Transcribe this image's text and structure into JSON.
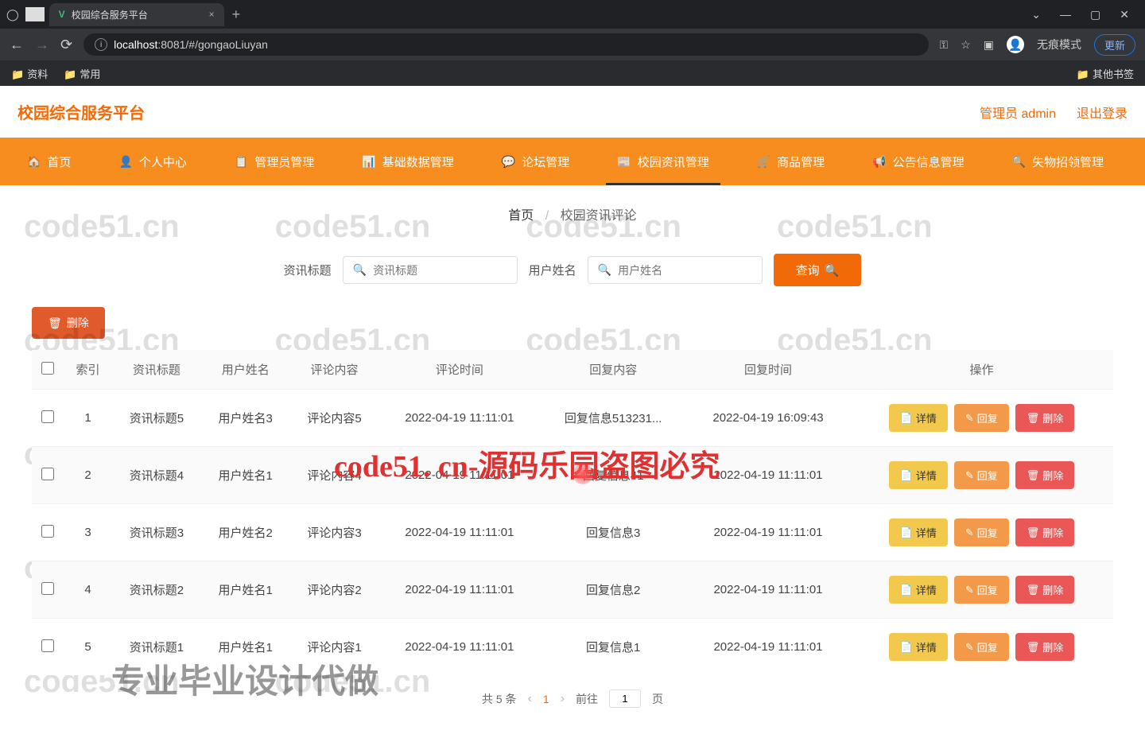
{
  "browser": {
    "tab_title": "校园综合服务平台",
    "url_host": "localhost",
    "url_rest": ":8081/#/gongaoLiuyan",
    "incognito_label": "无痕模式",
    "update_label": "更新",
    "bookmarks": [
      "资料",
      "常用"
    ],
    "other_bookmarks": "其他书签"
  },
  "header": {
    "title": "校园综合服务平台",
    "user_label": "管理员 admin",
    "logout": "退出登录"
  },
  "nav": {
    "items": [
      {
        "icon": "🏠",
        "label": "首页"
      },
      {
        "icon": "👤",
        "label": "个人中心"
      },
      {
        "icon": "📋",
        "label": "管理员管理"
      },
      {
        "icon": "📊",
        "label": "基础数据管理"
      },
      {
        "icon": "💬",
        "label": "论坛管理"
      },
      {
        "icon": "📰",
        "label": "校园资讯管理"
      },
      {
        "icon": "🛒",
        "label": "商品管理"
      },
      {
        "icon": "📢",
        "label": "公告信息管理"
      },
      {
        "icon": "🔍",
        "label": "失物招领管理"
      }
    ],
    "active_index": 5
  },
  "breadcrumb": {
    "home": "首页",
    "current": "校园资讯评论"
  },
  "search": {
    "label1": "资讯标题",
    "placeholder1": "资讯标题",
    "label2": "用户姓名",
    "placeholder2": "用户姓名",
    "query_btn": "查询"
  },
  "batch_delete": "删除",
  "table": {
    "headers": [
      "索引",
      "资讯标题",
      "用户姓名",
      "评论内容",
      "评论时间",
      "回复内容",
      "回复时间",
      "操作"
    ],
    "rows": [
      {
        "idx": "1",
        "title": "资讯标题5",
        "user": "用户姓名3",
        "comment": "评论内容5",
        "ctime": "2022-04-19 11:11:01",
        "reply": "回复信息513231...",
        "rtime": "2022-04-19 16:09:43"
      },
      {
        "idx": "2",
        "title": "资讯标题4",
        "user": "用户姓名1",
        "comment": "评论内容4",
        "ctime": "2022-04-19 11:11:01",
        "reply": "回复信息41",
        "rtime": "2022-04-19 11:11:01"
      },
      {
        "idx": "3",
        "title": "资讯标题3",
        "user": "用户姓名2",
        "comment": "评论内容3",
        "ctime": "2022-04-19 11:11:01",
        "reply": "回复信息3",
        "rtime": "2022-04-19 11:11:01"
      },
      {
        "idx": "4",
        "title": "资讯标题2",
        "user": "用户姓名1",
        "comment": "评论内容2",
        "ctime": "2022-04-19 11:11:01",
        "reply": "回复信息2",
        "rtime": "2022-04-19 11:11:01"
      },
      {
        "idx": "5",
        "title": "资讯标题1",
        "user": "用户姓名1",
        "comment": "评论内容1",
        "ctime": "2022-04-19 11:11:01",
        "reply": "回复信息1",
        "rtime": "2022-04-19 11:11:01"
      }
    ],
    "actions": {
      "detail": "详情",
      "reply": "回复",
      "del": "删除"
    }
  },
  "pager": {
    "total_label": "共 5 条",
    "current": "1",
    "goto_label": "前往",
    "goto_value": "1",
    "page_suffix": "页"
  },
  "watermark": {
    "repeat": "code51.cn",
    "main": "code51. cn-源码乐园盗图必究",
    "sub": "专业毕业设计代做"
  }
}
